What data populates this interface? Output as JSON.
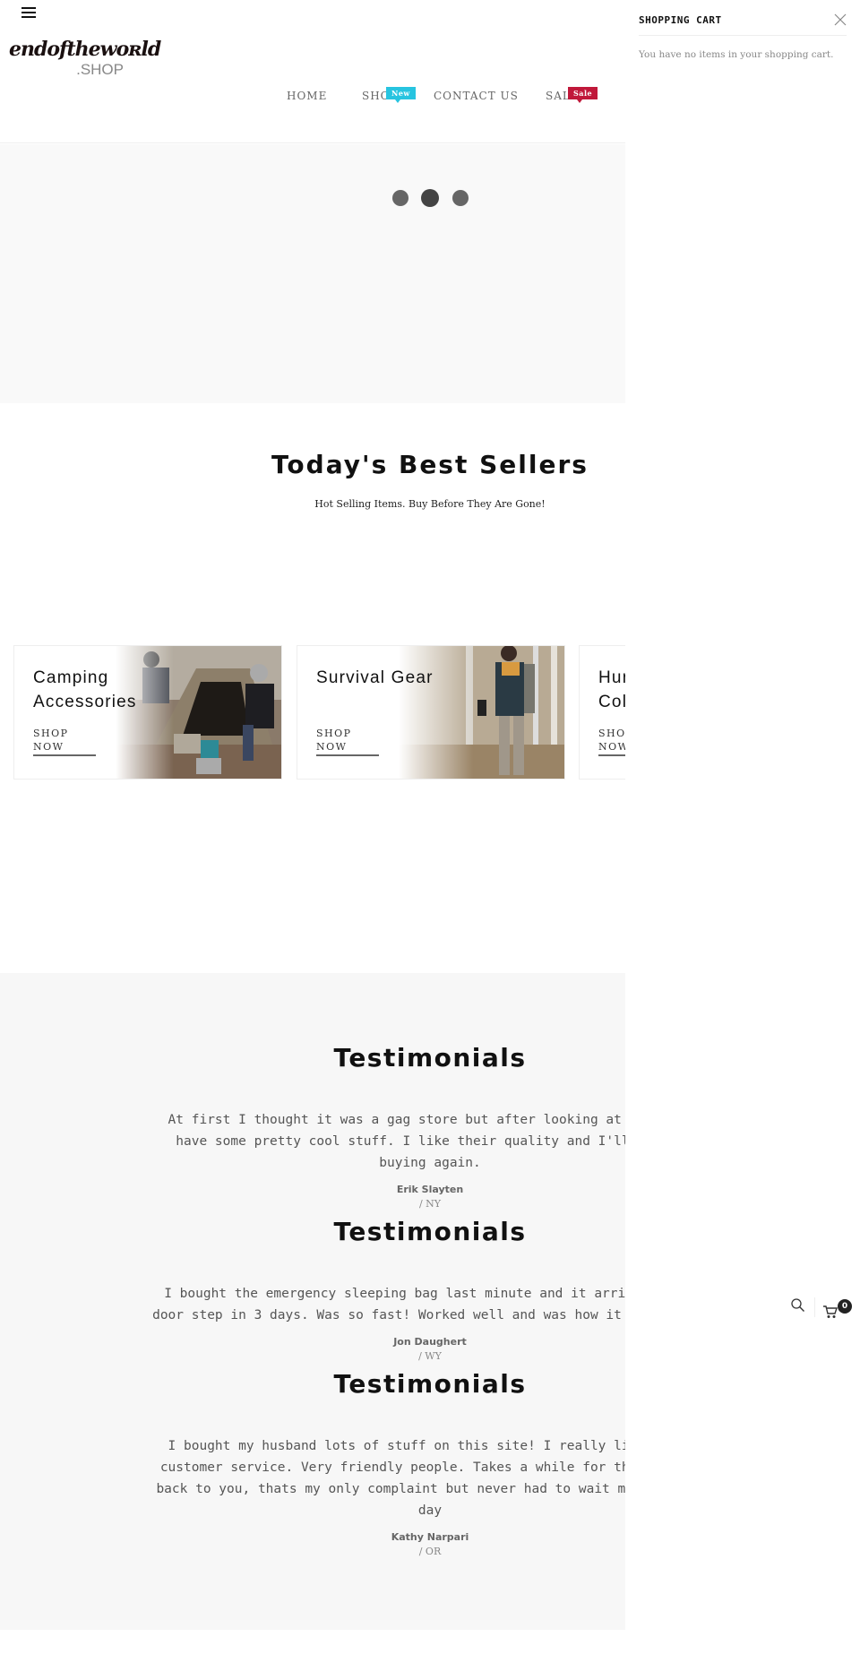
{
  "header": {
    "logo_main": "endofthewoʀld",
    "logo_sub": ".SHOP",
    "nav": [
      {
        "label": "HOME",
        "badge": null
      },
      {
        "label": "SHO",
        "badge": "New"
      },
      {
        "label": "CONTACT US",
        "badge": null
      },
      {
        "label": "SAL",
        "badge": "Sale"
      }
    ],
    "colors": {
      "badge_new": "#27c4e0",
      "badge_sale": "#c0183a"
    }
  },
  "cart_panel": {
    "title": "SHOPPING CART",
    "empty_message": "You have no items in your shopping cart."
  },
  "hero": {
    "slide_count": 3,
    "active_slide": 2
  },
  "best_sellers": {
    "title": "Today's Best Sellers",
    "subtitle": "Hot Selling Items. Buy Before They Are Gone!",
    "cards": [
      {
        "title": "Camping Accessories",
        "cta": "SHOP NOW",
        "image": "campers-by-tent-photo"
      },
      {
        "title": "Survival Gear",
        "cta": "SHOP NOW",
        "image": "hiker-in-woods-photo"
      },
      {
        "title": "Hunting Collection",
        "cta": "SHOP NOW",
        "image": ""
      }
    ]
  },
  "testimonials": [
    {
      "title": "Testimonials",
      "quote": "At first I thought it was a gag store but after looking at it, they have some pretty cool stuff. I like their quality and I'll def be buying again.",
      "name": "Erik Slayten",
      "location": "/  NY"
    },
    {
      "title": "Testimonials",
      "quote": "I bought the emergency sleeping bag last minute and it arrived at my door step in 3 days. Was so fast! Worked well and was how it described.",
      "name": "Jon Daughert",
      "location": "/  WY"
    },
    {
      "title": "Testimonials",
      "quote": "I bought my husband lots of stuff on this site! I really like their customer service. Very friendly people. Takes a while for them to get back to you, thats my only complaint but never had to wait more than a day",
      "name": "Kathy Narpari",
      "location": "/  OR"
    }
  ],
  "floating_tools": {
    "search_icon": "search-icon",
    "cart_icon": "cart-icon",
    "cart_count": "0"
  }
}
